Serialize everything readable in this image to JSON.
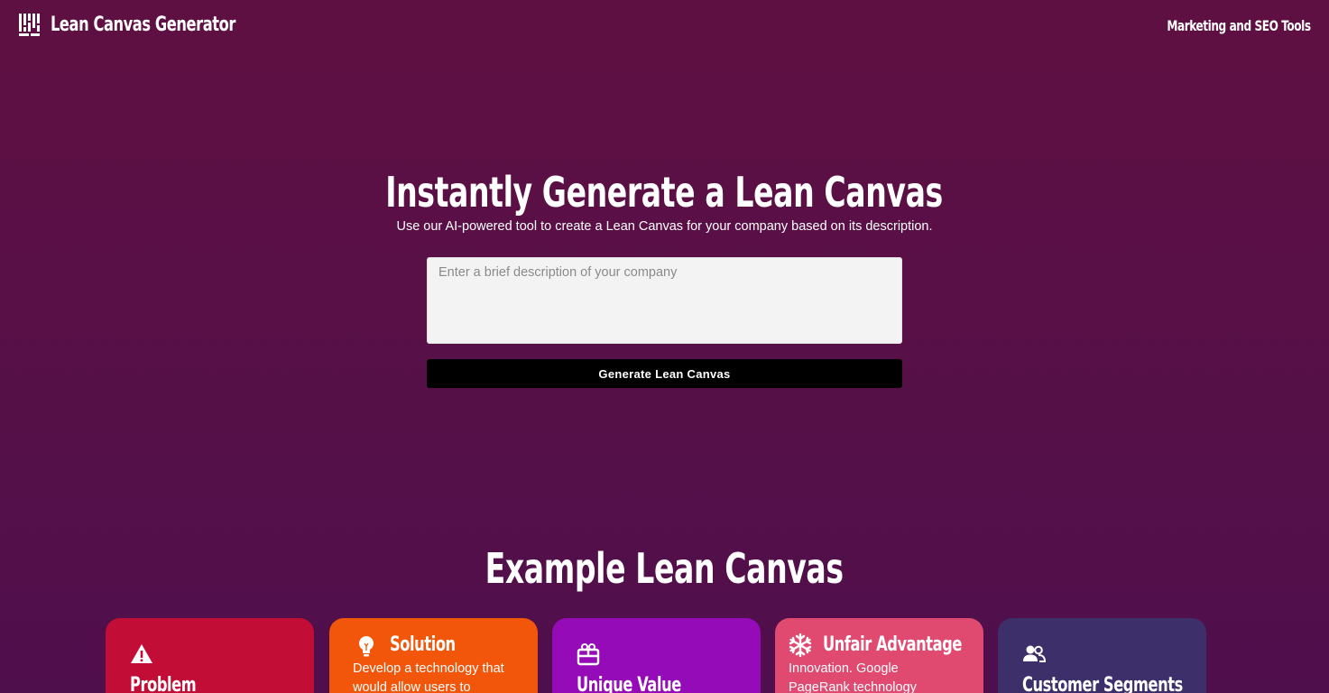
{
  "header": {
    "logo_text": "Lean Canvas Generator",
    "nav_link": "Marketing and SEO Tools"
  },
  "hero": {
    "title": "Instantly Generate a Lean Canvas",
    "subtitle": "Use our AI-powered tool to create a Lean Canvas for your company based on its description.",
    "input_placeholder": "Enter a brief description of your company",
    "input_value": "",
    "button_label": "Generate Lean Canvas"
  },
  "example": {
    "title": "Example Lean Canvas",
    "cards": [
      {
        "title": "Problem",
        "icon": "warning-icon",
        "text": "",
        "color": "#c20e36"
      },
      {
        "title": "Solution",
        "icon": "lightbulb-icon",
        "text": "Develop a technology that would allow users to",
        "color": "#f1560a"
      },
      {
        "title": "Unique Value",
        "icon": "gift-icon",
        "text": "",
        "color": "#950bb8"
      },
      {
        "title": "Unfair Advantage",
        "icon": "snowflake-icon",
        "text": "Innovation. Google PageRank technology",
        "color": "#e04970"
      },
      {
        "title": "Customer Segments",
        "icon": "users-icon",
        "text": "",
        "color": "#3c2f6a"
      }
    ]
  },
  "colors": {
    "background_top": "#5f1042",
    "background_bottom": "#4f0f4c",
    "button": "#000000",
    "input_bg": "#f3f3f3"
  }
}
